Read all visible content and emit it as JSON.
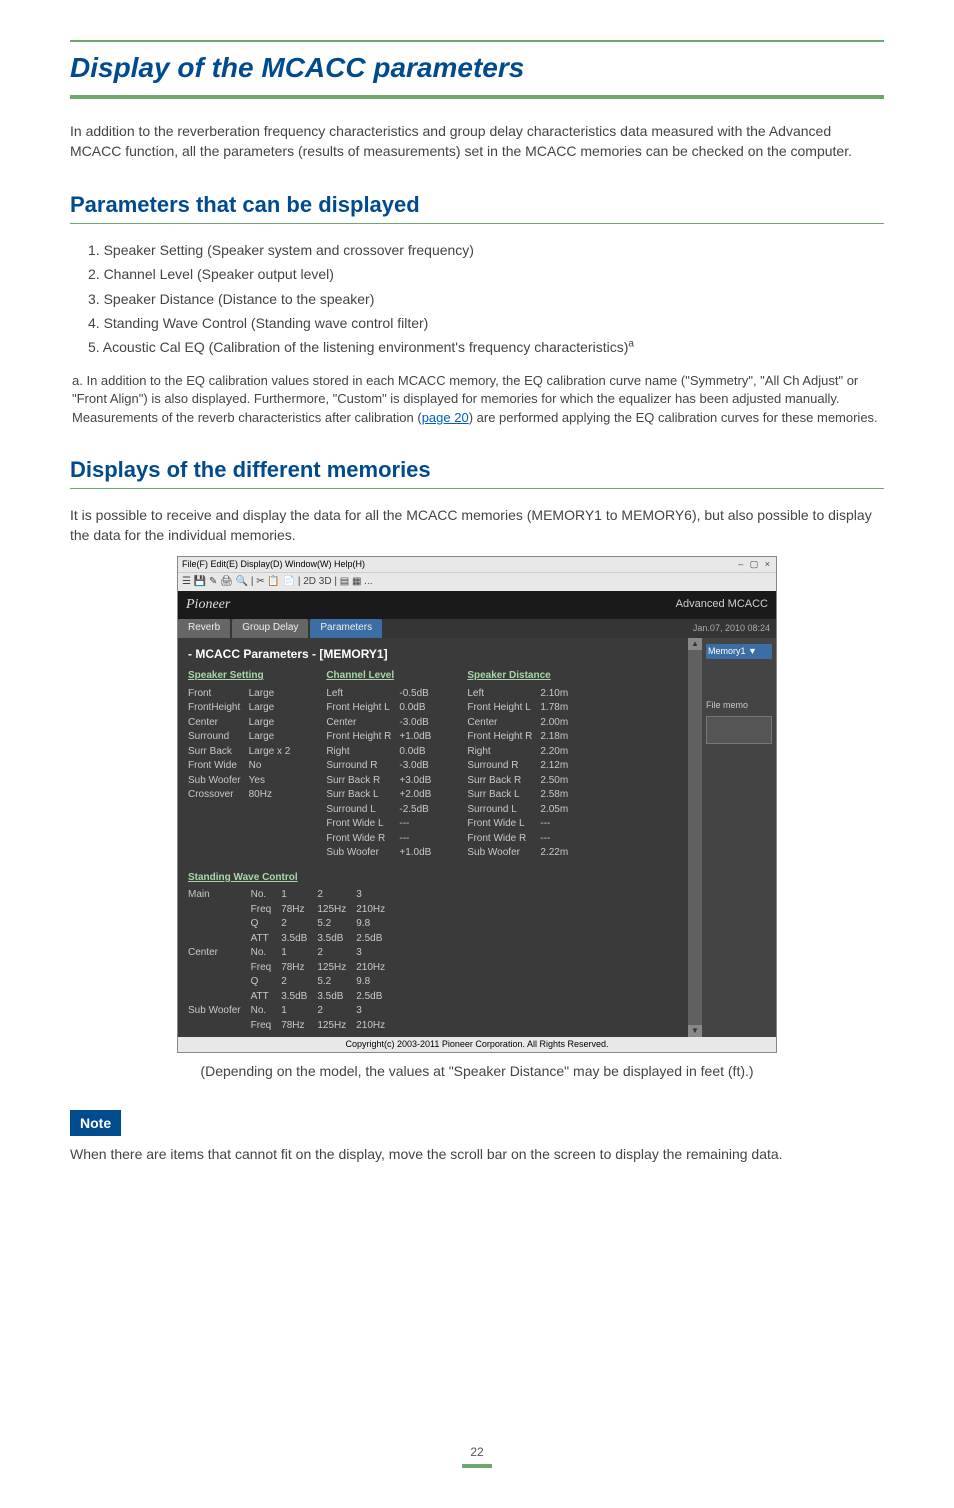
{
  "page": {
    "title": "Display of the MCACC parameters",
    "intro": "In addition to the reverberation frequency characteristics and group delay characteristics data measured with the Advanced MCACC function, all the parameters (results of measurements) set in the MCACC memories can be checked on the computer.",
    "page_number": "22"
  },
  "section1": {
    "heading": "Parameters that can be displayed",
    "items": [
      "1. Speaker Setting (Speaker system and crossover frequency)",
      "2. Channel Level (Speaker output level)",
      "3. Speaker Distance (Distance to the speaker)",
      "4. Standing Wave Control (Standing wave control filter)",
      "5. Acoustic Cal EQ (Calibration of the listening environment's frequency characteristics)"
    ],
    "superscript": "a",
    "footnote_prefix": "a. In addition to the EQ calibration values stored in each MCACC memory, the EQ calibration curve name (\"Symmetry\", \"All Ch Adjust\" or \"Front Align\") is also displayed. Furthermore, \"Custom\" is displayed for memories for which the equalizer has been adjusted manually. Measurements of the reverb characteristics after calibration (",
    "footnote_link": "page 20",
    "footnote_suffix": ") are performed applying the EQ calibration curves for these memories."
  },
  "section2": {
    "heading": "Displays of the different memories",
    "intro": "It is possible to receive and display the data for all the MCACC memories (MEMORY1 to MEMORY6), but also possible to display the data for the individual memories.",
    "caption": "(Depending on the model, the values at \"Speaker Distance\" may be displayed in feet (ft).)"
  },
  "note": {
    "badge": "Note",
    "text": "When there are items that cannot fit on the display, move the scroll bar on the screen to display the remaining data."
  },
  "app": {
    "menubar": "File(F)   Edit(E)   Display(D)   Window(W)   Help(H)",
    "toolbar_text": "2D  3D",
    "brand_left": "Pioneer",
    "brand_right": "Advanced MCACC",
    "tabs": {
      "reverb": "Reverb",
      "group_delay": "Group Delay",
      "parameters": "Parameters"
    },
    "date": "Jan.07, 2010 08:24",
    "content_heading": "- MCACC Parameters -      [MEMORY1]",
    "memory_selector": "Memory1",
    "file_memo_label": "File memo",
    "copyright": "Copyright(c) 2003-2011 Pioneer Corporation. All Rights Reserved.",
    "speaker_setting": {
      "title": "Speaker Setting",
      "rows": [
        [
          "Front",
          "Large"
        ],
        [
          "FrontHeight",
          "Large"
        ],
        [
          "Center",
          "Large"
        ],
        [
          "Surround",
          "Large"
        ],
        [
          "Surr Back",
          "Large x 2"
        ],
        [
          "Front Wide",
          "No"
        ],
        [
          "Sub Woofer",
          "Yes"
        ],
        [
          "Crossover",
          "80Hz"
        ]
      ]
    },
    "channel_level": {
      "title": "Channel Level",
      "rows": [
        [
          "Left",
          "-0.5dB"
        ],
        [
          "Front Height L",
          "0.0dB"
        ],
        [
          "Center",
          "-3.0dB"
        ],
        [
          "Front Height R",
          "+1.0dB"
        ],
        [
          "Right",
          "0.0dB"
        ],
        [
          "Surround R",
          "-3.0dB"
        ],
        [
          "Surr Back R",
          "+3.0dB"
        ],
        [
          "Surr Back L",
          "+2.0dB"
        ],
        [
          "Surround L",
          "-2.5dB"
        ],
        [
          "Front Wide L",
          "---"
        ],
        [
          "Front Wide R",
          "---"
        ],
        [
          "Sub Woofer",
          "+1.0dB"
        ]
      ]
    },
    "speaker_distance": {
      "title": "Speaker Distance",
      "rows": [
        [
          "Left",
          "2.10m"
        ],
        [
          "Front Height L",
          "1.78m"
        ],
        [
          "Center",
          "2.00m"
        ],
        [
          "Front Height R",
          "2.18m"
        ],
        [
          "Right",
          "2.20m"
        ],
        [
          "Surround R",
          "2.12m"
        ],
        [
          "Surr Back R",
          "2.50m"
        ],
        [
          "Surr Back L",
          "2.58m"
        ],
        [
          "Surround L",
          "2.05m"
        ],
        [
          "Front Wide L",
          "---"
        ],
        [
          "Front Wide R",
          "---"
        ],
        [
          "Sub Woofer",
          "2.22m"
        ]
      ]
    },
    "standing_wave": {
      "title": "Standing Wave Control",
      "channels": [
        "Main",
        "Center",
        "Sub Woofer"
      ],
      "labels": [
        "No.",
        "Freq",
        "Q",
        "ATT"
      ],
      "cols_header": [
        "1",
        "2",
        "3"
      ],
      "main": [
        [
          "1",
          "2",
          "3"
        ],
        [
          "78Hz",
          "125Hz",
          "210Hz"
        ],
        [
          "2",
          "5.2",
          "9.8"
        ],
        [
          "3.5dB",
          "3.5dB",
          "2.5dB"
        ]
      ],
      "center": [
        [
          "1",
          "2",
          "3"
        ],
        [
          "78Hz",
          "125Hz",
          "210Hz"
        ],
        [
          "2",
          "5.2",
          "9.8"
        ],
        [
          "3.5dB",
          "3.5dB",
          "2.5dB"
        ]
      ],
      "subwoofer": [
        [
          "1",
          "2",
          "3"
        ],
        [
          "78Hz",
          "125Hz",
          "210Hz"
        ]
      ]
    }
  }
}
